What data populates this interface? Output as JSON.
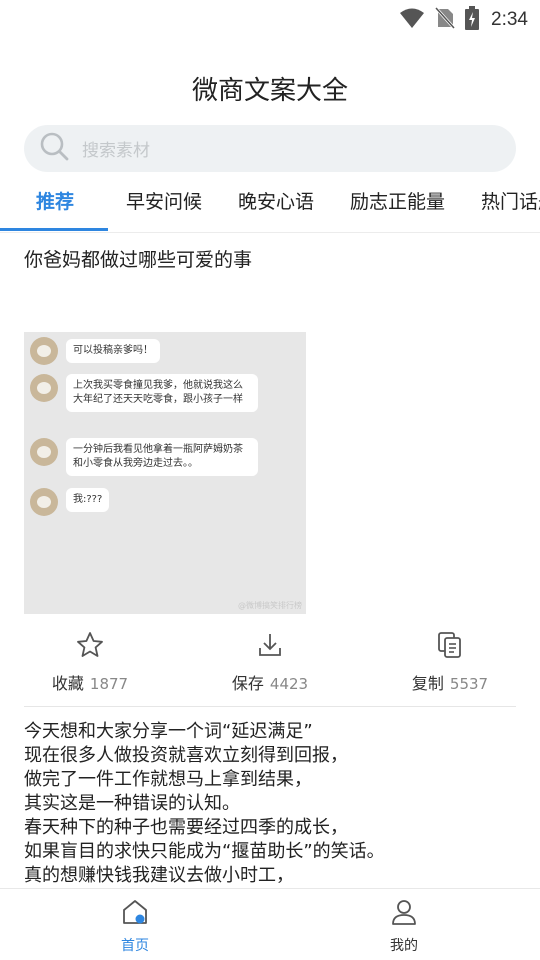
{
  "status_bar": {
    "time": "2:34",
    "icons": [
      "wifi-icon",
      "no-sim-icon",
      "battery-charging-icon"
    ]
  },
  "app_title": "微商文案大全",
  "search": {
    "placeholder": "搜索素材"
  },
  "tabs": [
    {
      "label": "推荐",
      "active": true
    },
    {
      "label": "早安问候",
      "active": false
    },
    {
      "label": "晚安心语",
      "active": false
    },
    {
      "label": "励志正能量",
      "active": false
    },
    {
      "label": "热门话题",
      "active": false
    }
  ],
  "post": {
    "title": "你爸妈都做过哪些可爱的事",
    "image": {
      "messages": [
        "可以投稿亲爹吗！",
        "上次我买零食撞见我爹，他就说我这么大年纪了还天天吃零食，跟小孩子一样",
        "一分钟后我看见他拿着一瓶阿萨姆奶茶和小零食从我旁边走过去。。",
        "我:???"
      ],
      "watermark": "@微博搞笑排行榜"
    },
    "actions": [
      {
        "label": "收藏",
        "count": "1877",
        "icon": "star-icon"
      },
      {
        "label": "保存",
        "count": "4423",
        "icon": "download-icon"
      },
      {
        "label": "复制",
        "count": "5537",
        "icon": "copy-icon"
      }
    ],
    "body_lines": [
      "今天想和大家分享一个词“延迟满足”",
      "现在很多人做投资就喜欢立刻得到回报，",
      "做完了一件工作就想马上拿到结果，",
      "其实这是一种错误的认知。",
      "春天种下的种子也需要经过四季的成长，",
      "如果盲目的求快只能成为“揠苗助长”的笑话。",
      "真的想赚快钱我建议去做小时工，"
    ]
  },
  "bottom_nav": [
    {
      "label": "首页",
      "active": true,
      "icon": "home-icon"
    },
    {
      "label": "我的",
      "active": false,
      "icon": "profile-icon"
    }
  ],
  "colors": {
    "accent": "#2e86e0",
    "text": "#222222",
    "muted": "#888888",
    "search_bg": "#eef1f3"
  }
}
